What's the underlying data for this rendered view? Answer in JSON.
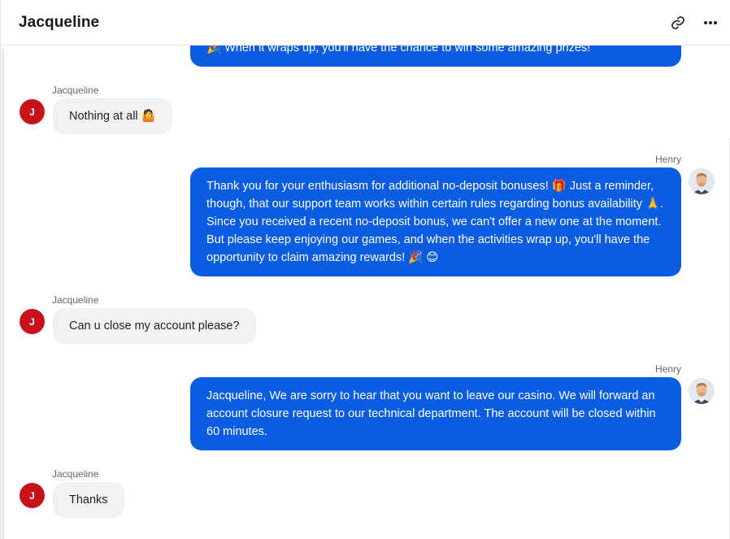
{
  "header": {
    "title": "Jacqueline",
    "link_icon": "link-icon",
    "more_icon": "more-horizontal-icon"
  },
  "messages": [
    {
      "sender": "",
      "text": "🎉 When it wraps up, you'll have the chance to win some amazing prizes!"
    },
    {
      "sender": "Jacqueline",
      "avatar": "J",
      "text": "Nothing at all 🤷"
    },
    {
      "sender": "Henry",
      "text": "Thank you for your enthusiasm for additional no-deposit bonuses! 🎁 Just a reminder, though, that our support team works within certain rules regarding bonus availability 🙏. Since you received a recent no-deposit bonus, we can't offer a new one at the moment. But please keep enjoying our games, and when the activities wrap up, you'll have the opportunity to claim amazing rewards! 🎉 😊"
    },
    {
      "sender": "Jacqueline",
      "avatar": "J",
      "text": "Can u close my account please?"
    },
    {
      "sender": "Henry",
      "text": "Jacqueline, We are sorry to hear that you want to leave our casino. We will forward an account closure request to our technical department. The account will be closed within 60 minutes."
    },
    {
      "sender": "Jacqueline",
      "avatar": "J",
      "text": "Thanks"
    }
  ],
  "colors": {
    "outgoing_bubble": "#0a5ce0",
    "incoming_bubble": "#f2f2f2",
    "avatar_red": "#c8121b"
  }
}
